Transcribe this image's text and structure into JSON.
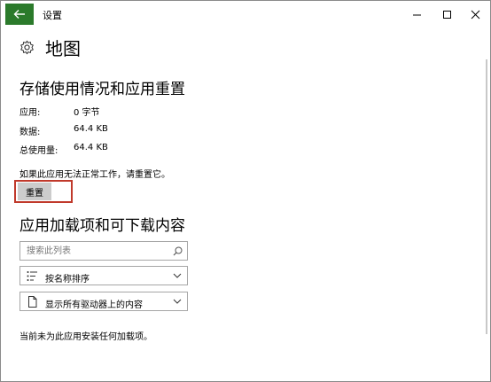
{
  "window": {
    "title": "设置",
    "controls": [
      "minimize-icon",
      "maximize-icon",
      "close-icon"
    ]
  },
  "header": {
    "icon": "gear-icon",
    "title": "地图"
  },
  "storage": {
    "title": "存储使用情况和应用重置",
    "rows": [
      {
        "label": "应用:",
        "value": "0 字节"
      },
      {
        "label": "数据:",
        "value": "64.4 KB"
      },
      {
        "label": "总使用量:",
        "value": "64.4 KB"
      }
    ],
    "hint": "如果此应用无法正常工作，请重置它。",
    "reset_label": "重置",
    "highlight_color": "#c0392b"
  },
  "addons": {
    "title": "应用加载项和可下载内容",
    "search_placeholder": "搜索此列表",
    "sort_selected": "按名称排序",
    "filter_selected": "显示所有驱动器上的内容",
    "empty_note": "当前未为此应用安装任何加载项。"
  },
  "colors": {
    "accent": "#2b7a2b",
    "button_bg": "#cccccc"
  }
}
